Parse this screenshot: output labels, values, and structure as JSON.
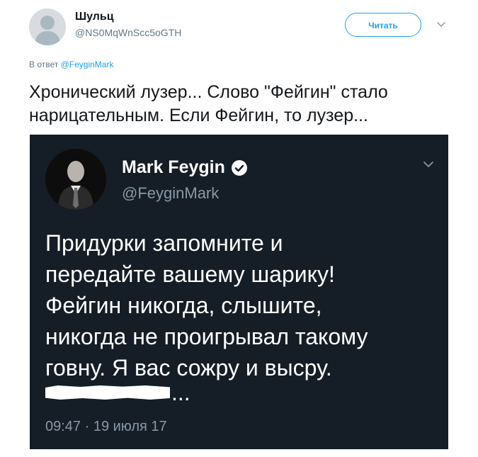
{
  "tweet": {
    "author": {
      "name": "Шульц",
      "handle": "@NS0MqWnScc5oGTH"
    },
    "follow_label": "Читать",
    "reply_prefix": "В ответ",
    "reply_mention": "@FeyginMark",
    "text": "Хронический лузер...  Слово \"Фейгин\" стало\nнарицательным. Если Фейгин, то лузер..."
  },
  "embedded_tweet": {
    "name": "Mark Feygin",
    "handle": "@FeyginMark",
    "text": "Придурки запомните и\nпередайте вашему шарику!\nФейгин никогда, слышите,\nникогда не проигрывал такому\nговну. Я вас сожру и высру.",
    "trailing_ellipsis": "...",
    "timestamp": "09:47 · 19 июля 17"
  },
  "icons": {
    "avatar": "default-avatar-icon",
    "caret": "chevron-down-icon",
    "verified": "verified-badge-icon"
  },
  "colors": {
    "accent": "#1da1f2",
    "muted": "#657786",
    "embed_background": "#151d26",
    "embed_muted": "#8899a6"
  }
}
